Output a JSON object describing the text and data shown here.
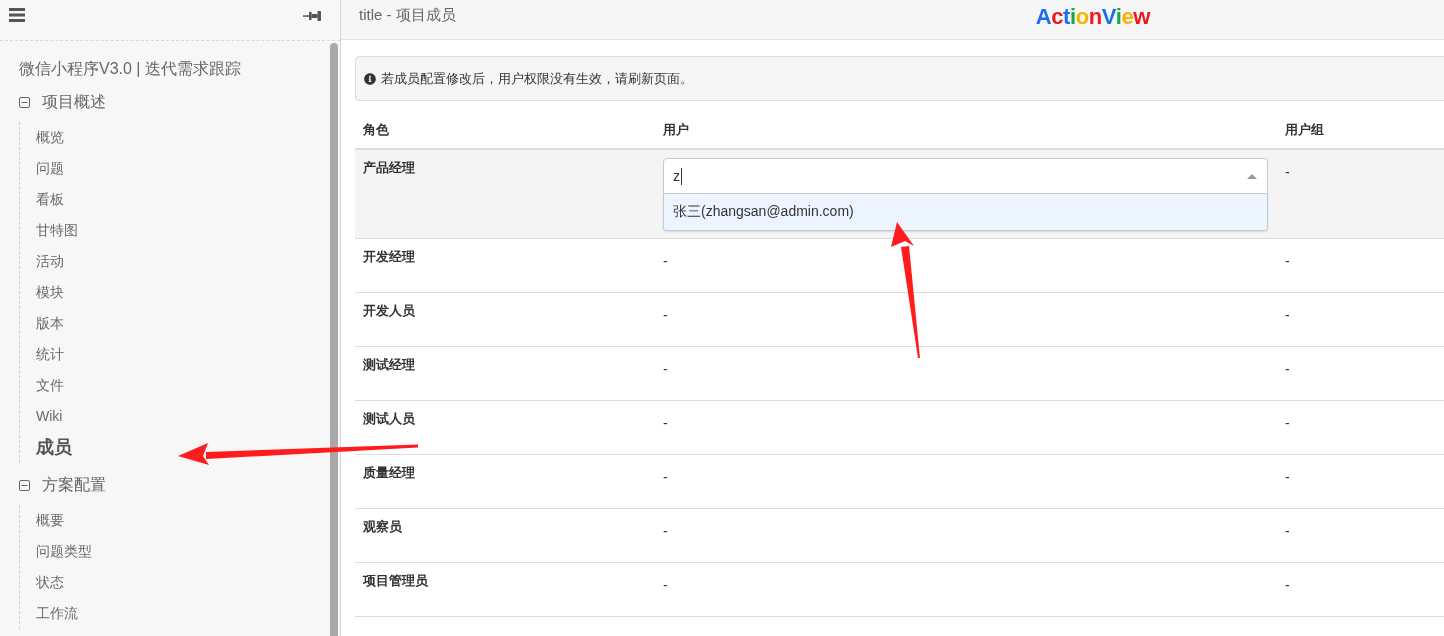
{
  "sidebar": {
    "project_title": "微信小程序V3.0 | 迭代需求跟踪",
    "groups": [
      {
        "label": "项目概述",
        "expanded": true,
        "items": [
          {
            "label": "概览",
            "selected": false
          },
          {
            "label": "问题",
            "selected": false
          },
          {
            "label": "看板",
            "selected": false
          },
          {
            "label": "甘特图",
            "selected": false
          },
          {
            "label": "活动",
            "selected": false
          },
          {
            "label": "模块",
            "selected": false
          },
          {
            "label": "版本",
            "selected": false
          },
          {
            "label": "统计",
            "selected": false
          },
          {
            "label": "文件",
            "selected": false
          },
          {
            "label": "Wiki",
            "selected": false
          },
          {
            "label": "成员",
            "selected": true
          }
        ]
      },
      {
        "label": "方案配置",
        "expanded": true,
        "items": [
          {
            "label": "概要",
            "selected": false
          },
          {
            "label": "问题类型",
            "selected": false
          },
          {
            "label": "状态",
            "selected": false
          },
          {
            "label": "工作流",
            "selected": false
          }
        ]
      }
    ]
  },
  "header": {
    "title": "title - 项目成员",
    "logo": {
      "letters": [
        {
          "text": "A",
          "color": "#1a6ef5"
        },
        {
          "text": "c",
          "color": "#f01818"
        },
        {
          "text": "t",
          "color": "#1a6ef5"
        },
        {
          "text": "i",
          "color": "#18a84a"
        },
        {
          "text": "o",
          "color": "#f5b400"
        },
        {
          "text": "n",
          "color": "#f01818"
        },
        {
          "text": "V",
          "color": "#1a6ef5"
        },
        {
          "text": "i",
          "color": "#18a84a"
        },
        {
          "text": "e",
          "color": "#f5b400"
        },
        {
          "text": "w",
          "color": "#f01818"
        }
      ]
    }
  },
  "notice": {
    "text": "若成员配置修改后，用户权限没有生效，请刷新页面。"
  },
  "table": {
    "columns": [
      "角色",
      "用户",
      "用户组"
    ],
    "rows": [
      {
        "role": "产品经理",
        "users": {
          "kind": "select",
          "value": "z",
          "open": true,
          "options": [
            {
              "label": "张三(zhangsan@admin.com)",
              "selected": true
            }
          ]
        },
        "user_group": "-"
      },
      {
        "role": "开发经理",
        "users": {
          "kind": "text",
          "text": "-"
        },
        "user_group": "-"
      },
      {
        "role": "开发人员",
        "users": {
          "kind": "text",
          "text": "-"
        },
        "user_group": "-"
      },
      {
        "role": "测试经理",
        "users": {
          "kind": "text",
          "text": "-"
        },
        "user_group": "-"
      },
      {
        "role": "测试人员",
        "users": {
          "kind": "text",
          "text": "-"
        },
        "user_group": "-"
      },
      {
        "role": "质量经理",
        "users": {
          "kind": "text",
          "text": "-"
        },
        "user_group": "-"
      },
      {
        "role": "观察员",
        "users": {
          "kind": "text",
          "text": "-"
        },
        "user_group": "-"
      },
      {
        "role": "项目管理员",
        "users": {
          "kind": "text",
          "text": "-"
        },
        "user_group": "-"
      }
    ]
  }
}
